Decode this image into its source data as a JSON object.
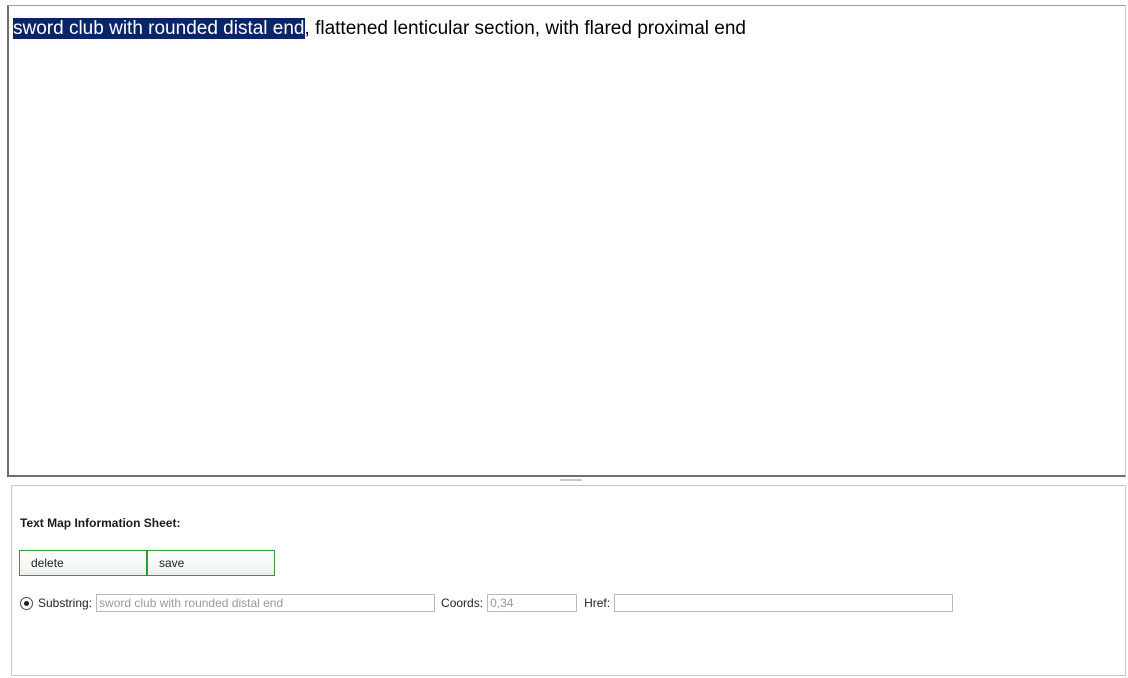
{
  "editor": {
    "selected_text": "sword club with rounded distal end",
    "rest_text": ", flattened lenticular section, with flared proximal end"
  },
  "info_sheet": {
    "title": "Text Map Information Sheet:",
    "buttons": {
      "delete_label": "delete",
      "save_label": "save"
    },
    "fields": {
      "substring_label": "Substring:",
      "substring_value": "sword club with rounded distal end",
      "coords_label": "Coords:",
      "coords_value": "0,34",
      "href_label": "Href:",
      "href_value": ""
    },
    "substring_radio_selected": true
  },
  "colors": {
    "selection_bg": "#0a246a",
    "button_border": "#2f9c2f"
  }
}
